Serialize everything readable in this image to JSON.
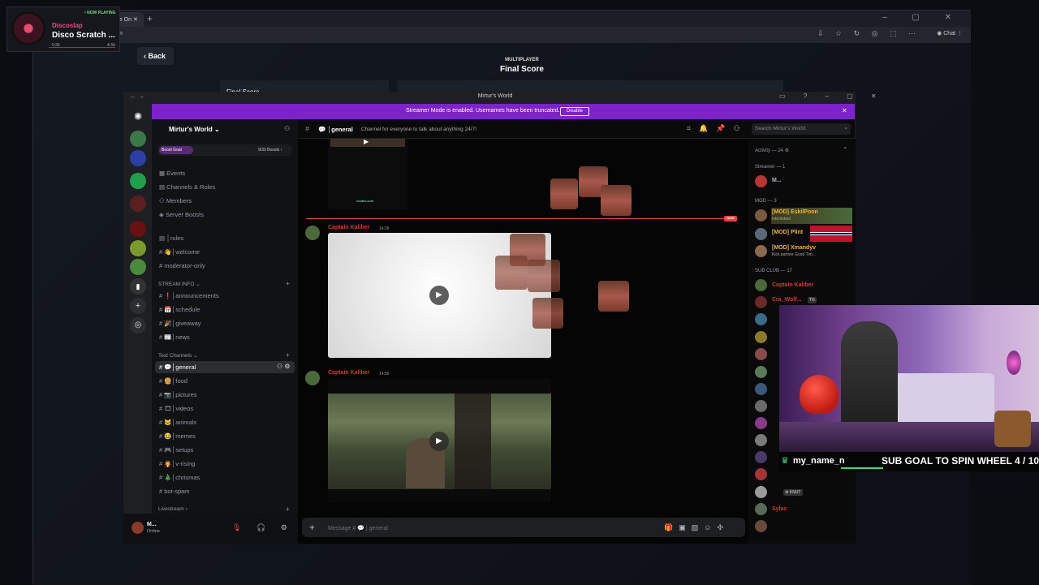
{
  "browser": {
    "tab_label": "me On",
    "url_fragment": "m",
    "chat_label": "Chat"
  },
  "game": {
    "back_label": "Back",
    "mode_label": "MULTIPLAYER",
    "title": "Final Score",
    "panel_label": "Final Score"
  },
  "now_playing": {
    "badge": "• NOW PLAYING",
    "artist": "Discoslap",
    "title": "Disco Scratch ...",
    "elapsed": "0:36",
    "duration": "4:34"
  },
  "discord": {
    "window_title": "Mirtur's World",
    "banner_text": "Streamer Mode is enabled. Usernames have been truncated.",
    "banner_button": "Disable",
    "server_name": "Mirtur's World",
    "boost_goal_label": "Boost Goal",
    "boost_count": "9/33 Boosts",
    "nav_items": [
      "Events",
      "Channels & Roles",
      "Members",
      "Server Boosts"
    ],
    "channels_top": [
      "rules",
      "welcome",
      "moderator-only"
    ],
    "category_stream_info": "STREAM INFO",
    "stream_info_channels": [
      "announcements",
      "schedule",
      "giveaway",
      "news"
    ],
    "category_text": "Text Channels",
    "text_channels": [
      "general",
      "food",
      "pictures",
      "videos",
      "animals",
      "memes",
      "setups",
      "v-rising",
      "chrismas",
      "bot-spam"
    ],
    "category_livestream": "Livestream",
    "user": {
      "name": "M...",
      "status": "Online"
    },
    "channel": {
      "name": "general",
      "topic": "Channel for everyone to talk about anything 24/7!",
      "search_placeholder": "Search Mirtur's World"
    },
    "new_badge": "NEW",
    "media_caption": "xxxabc.com",
    "messages": [
      {
        "author": "Captain Kaliber",
        "time": "14:26"
      },
      {
        "author": "Captain Kaliber",
        "time": "14:56"
      }
    ],
    "input_placeholder": "Message # 💬 | general",
    "members_header": "Activity — 24",
    "member_groups": {
      "streamer": "Streamer — 1",
      "mod": "MOD — 3",
      "subclub": "SUB CLUB — 17"
    },
    "streamers": [
      {
        "name": "M...",
        "color": "#b5bac1"
      }
    ],
    "mods": [
      {
        "name": "[MOD] EskilPoon",
        "sub": "interlinked",
        "color": "#f0b132"
      },
      {
        "name": "[MOD] Plint",
        "sub": "",
        "color": "#f0b132"
      },
      {
        "name": "[MOD] Xmandyv",
        "sub": "Kick partner Good Tim...",
        "color": "#f0b132"
      }
    ],
    "subclub": [
      {
        "name": "Captain Kaliber",
        "color": "#e0342e"
      },
      {
        "name": "Cra_Wolf...",
        "color": "#e0342e"
      },
      {
        "name": "Sylas",
        "color": "#e0342e"
      }
    ],
    "member_tags": {
      "tg": "TG",
      "knut": "KNUT"
    }
  },
  "webcam": {
    "username": "my_name_n",
    "goal_text": "SUB GOAL TO SPIN WHEEL 4 / 10"
  }
}
